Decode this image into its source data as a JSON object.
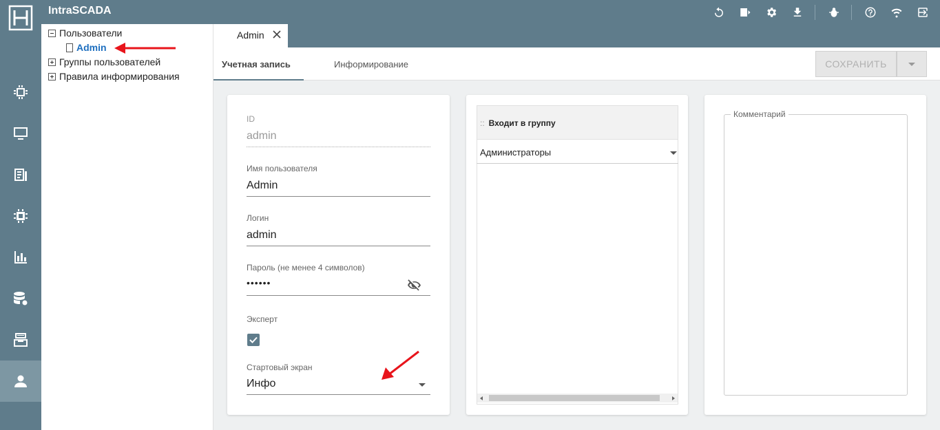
{
  "app": {
    "title": "IntraSCADA"
  },
  "toolbar": {
    "icons": [
      "refresh-icon",
      "screen-play-icon",
      "settings-icon",
      "download-icon",
      "bug-icon",
      "help-icon",
      "wifi-icon",
      "logout-icon"
    ]
  },
  "nav": {
    "items": [
      "cpu-icon",
      "monitor-icon",
      "report-icon",
      "chip-icon",
      "bar-chart-icon",
      "database-settings-icon",
      "archive-icon",
      "user-icon"
    ],
    "active": "user-icon"
  },
  "tree": {
    "users_label": "Пользователи",
    "admin_label": "Admin",
    "groups_label": "Группы пользователей",
    "rules_label": "Правила информирования"
  },
  "tabs": {
    "open_tab": "Admin",
    "account_tab": "Учетная запись",
    "notify_tab": "Информирование",
    "save_label": "СОХРАНИТЬ"
  },
  "form": {
    "id_label": "ID",
    "id_value": "admin",
    "username_label": "Имя пользователя",
    "username_value": "Admin",
    "login_label": "Логин",
    "login_value": "admin",
    "password_label": "Пароль (не менее 4 символов)",
    "password_value": "••••••",
    "expert_label": "Эксперт",
    "expert_checked": true,
    "start_screen_label": "Стартовый экран",
    "start_screen_value": "Инфо"
  },
  "group": {
    "header_grip": "::",
    "header": "Входит в группу",
    "value": "Администраторы"
  },
  "comment": {
    "label": "Комментарий"
  },
  "colors": {
    "topbar": "#5f7c8b",
    "rail_active": "#7d97a3",
    "link": "#1e6fbf",
    "annotation_arrow": "#e8141b"
  }
}
